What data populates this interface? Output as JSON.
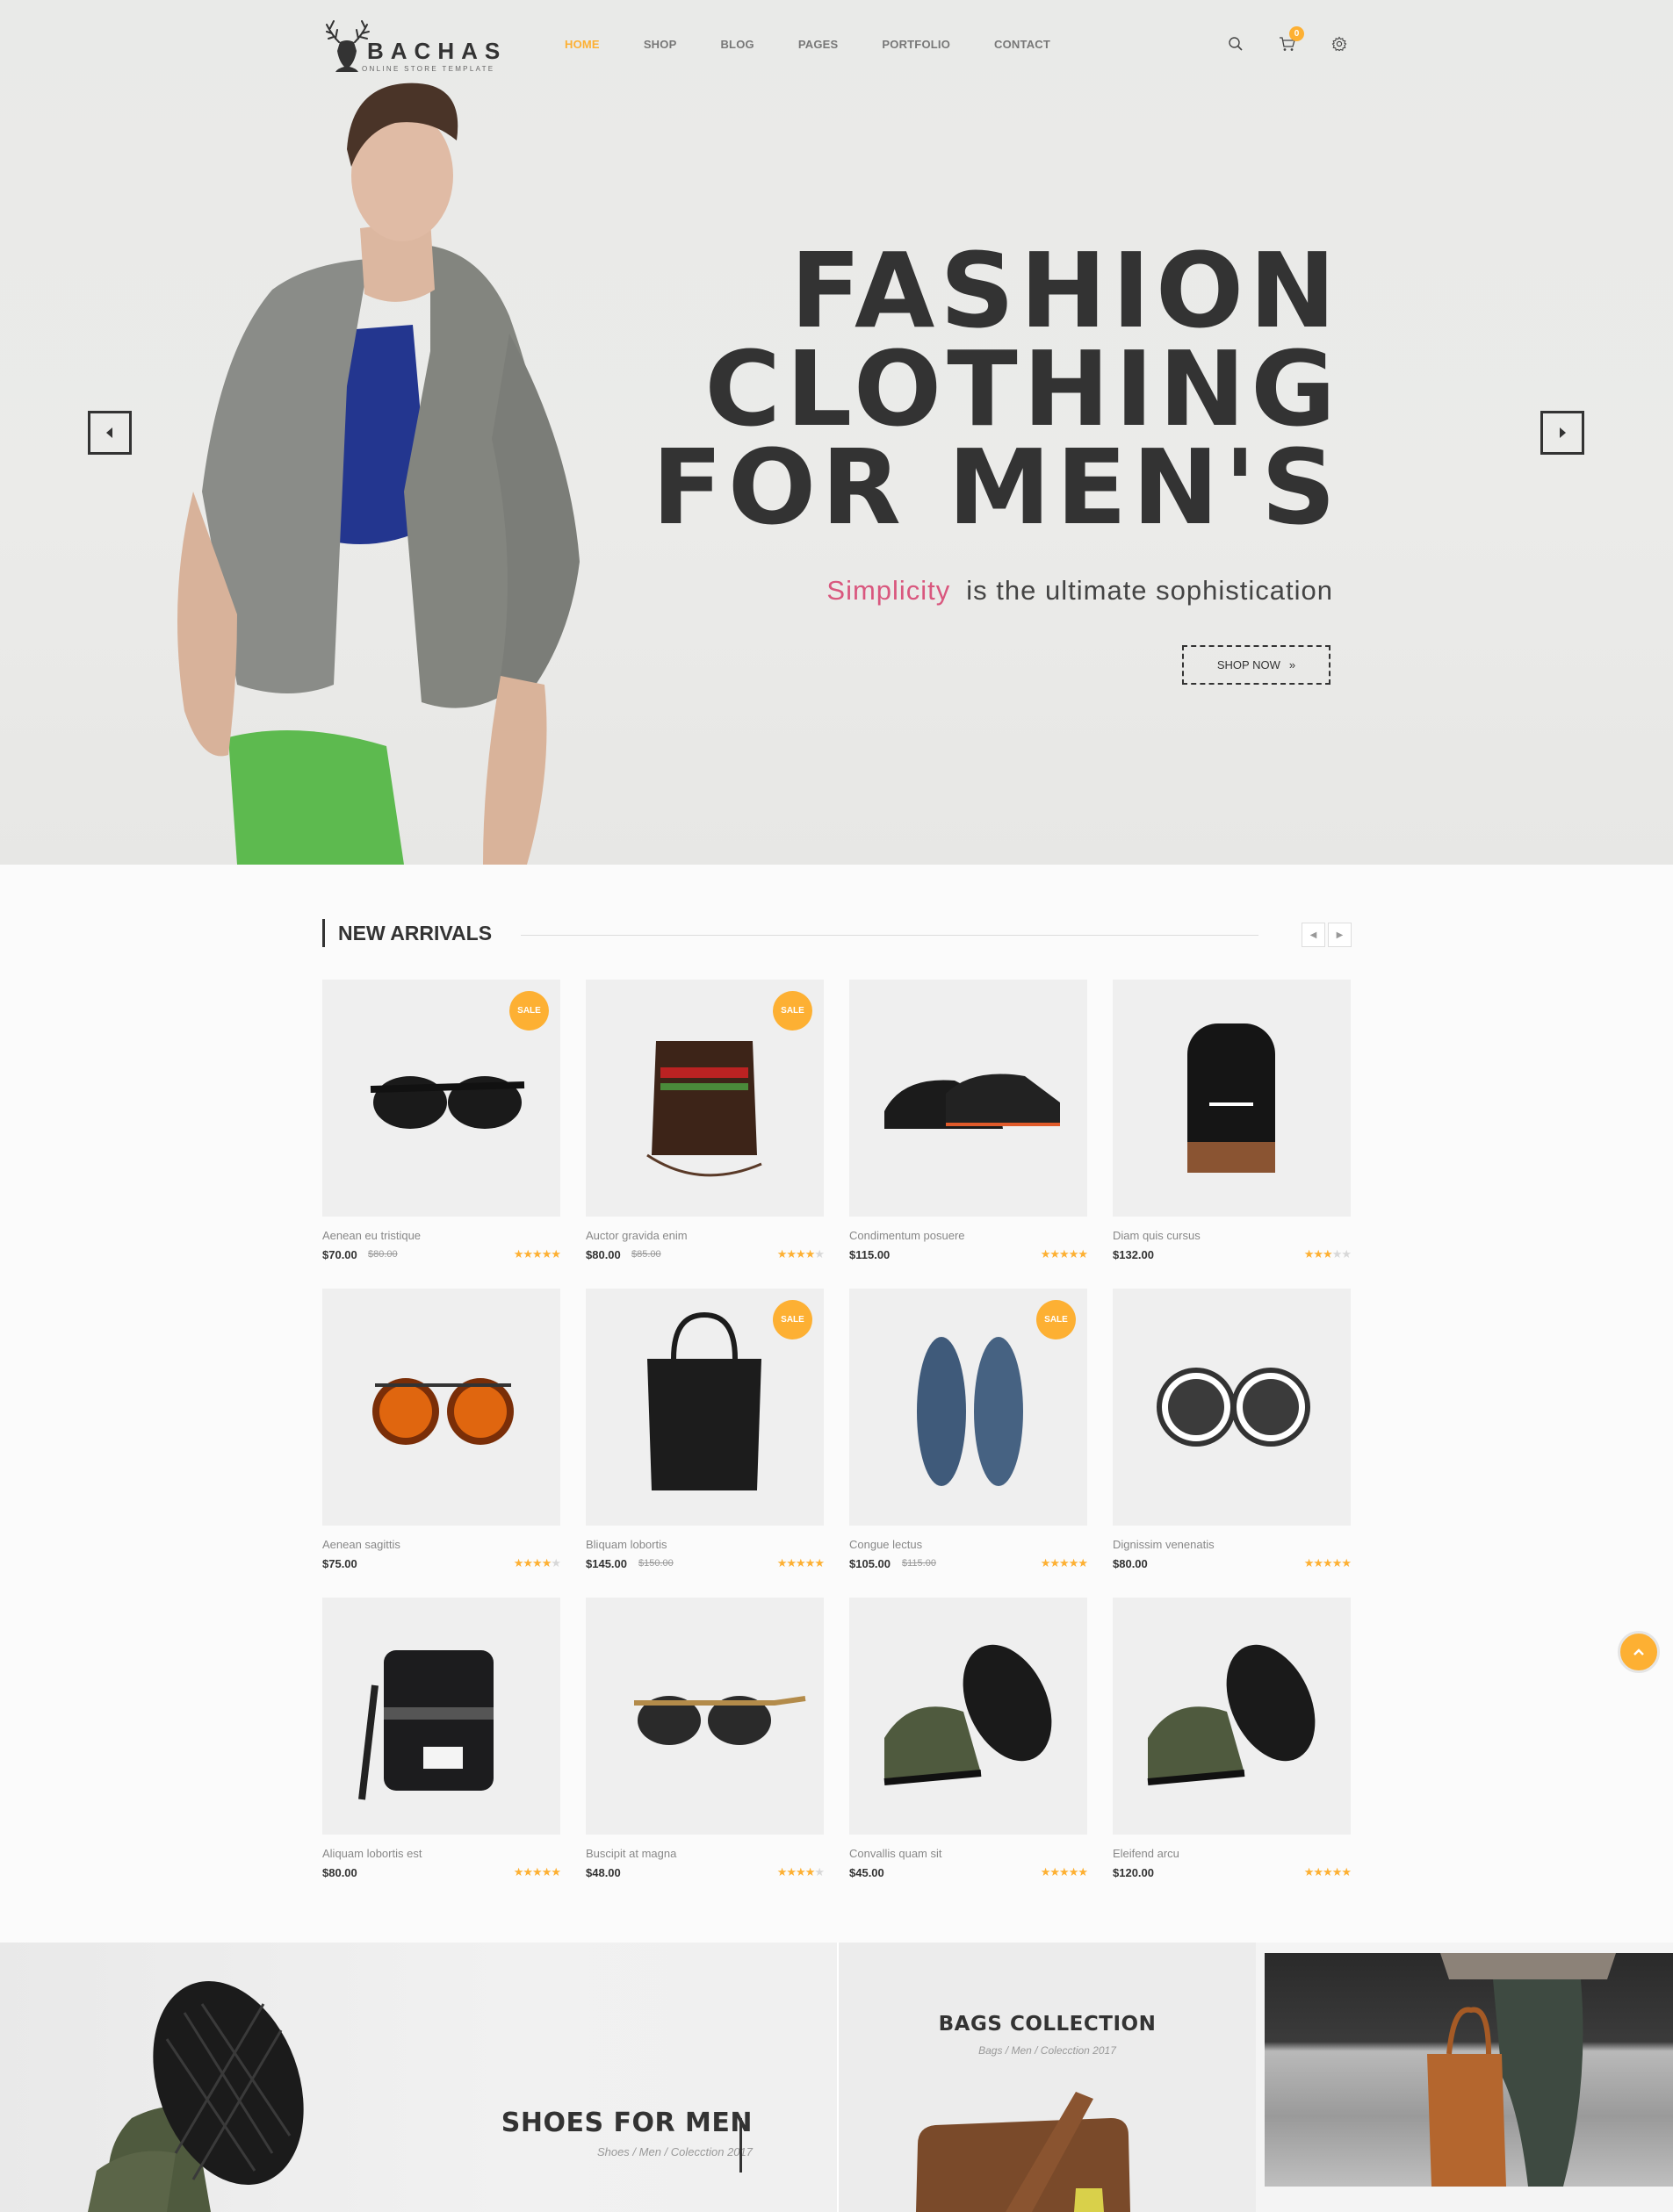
{
  "brand": {
    "name": "BACHAS",
    "tagline": "ONLINE STORE TEMPLATE"
  },
  "nav": {
    "items": [
      {
        "label": "HOME",
        "active": true
      },
      {
        "label": "SHOP",
        "active": false
      },
      {
        "label": "BLOG",
        "active": false
      },
      {
        "label": "PAGES",
        "active": false
      },
      {
        "label": "PORTFOLIO",
        "active": false
      },
      {
        "label": "CONTACT",
        "active": false
      }
    ]
  },
  "header_icons": {
    "search": "search-icon",
    "cart": "cart-icon",
    "cart_count": "0",
    "settings": "gear-icon"
  },
  "hero": {
    "title_line1": "FASHION",
    "title_line2": "CLOTHING",
    "title_line3": "FOR MEN'S",
    "subtitle_accent": "Simplicity",
    "subtitle_rest": "is the ultimate sophistication",
    "cta_label": "SHOP NOW",
    "cta_icon": "»",
    "accent_color": "#d9577e"
  },
  "new_arrivals": {
    "title": "NEW ARRIVALS",
    "sale_label": "SALE",
    "products": [
      {
        "name": "Aenean eu tristique",
        "price": "$70.00",
        "old_price": "$80.00",
        "rating": 5,
        "sale": true,
        "image": "sunglasses-black"
      },
      {
        "name": "Auctor gravida enim",
        "price": "$80.00",
        "old_price": "$85.00",
        "rating": 4,
        "sale": true,
        "image": "leather-pouch"
      },
      {
        "name": "Condimentum posuere",
        "price": "$115.00",
        "old_price": "",
        "rating": 5,
        "sale": false,
        "image": "black-shoes"
      },
      {
        "name": "Diam quis cursus",
        "price": "$132.00",
        "old_price": "",
        "rating": 3,
        "sale": false,
        "image": "backpack"
      },
      {
        "name": "Aenean sagittis",
        "price": "$75.00",
        "old_price": "",
        "rating": 4,
        "sale": false,
        "image": "sunglasses-orange"
      },
      {
        "name": "Bliquam lobortis",
        "price": "$145.00",
        "old_price": "$150.00",
        "rating": 5,
        "sale": true,
        "image": "tote-black"
      },
      {
        "name": "Congue lectus",
        "price": "$105.00",
        "old_price": "$115.00",
        "rating": 5,
        "sale": true,
        "image": "blue-shoes"
      },
      {
        "name": "Dignissim venenatis",
        "price": "$80.00",
        "old_price": "",
        "rating": 5,
        "sale": false,
        "image": "sunglasses-round"
      },
      {
        "name": "Aliquam lobortis est",
        "price": "$80.00",
        "old_price": "",
        "rating": 5,
        "sale": false,
        "image": "shoulder-bag"
      },
      {
        "name": "Buscipit at magna",
        "price": "$48.00",
        "old_price": "",
        "rating": 4,
        "sale": false,
        "image": "sunglasses-gold"
      },
      {
        "name": "Convallis quam sit",
        "price": "$45.00",
        "old_price": "",
        "rating": 5,
        "sale": false,
        "image": "green-sneakers"
      },
      {
        "name": "Eleifend arcu",
        "price": "$120.00",
        "old_price": "",
        "rating": 5,
        "sale": false,
        "image": "green-sneakers"
      }
    ]
  },
  "banners": {
    "shoes": {
      "title": "SHOES FOR MEN",
      "sub": "Shoes / Men / Colecction 2017"
    },
    "bags": {
      "title": "BAGS COLLECTION",
      "sub": "Bags / Men / Colecction 2017"
    }
  },
  "colors": {
    "accent": "#fdb033",
    "text_dark": "#333333",
    "pink": "#d9577e"
  }
}
